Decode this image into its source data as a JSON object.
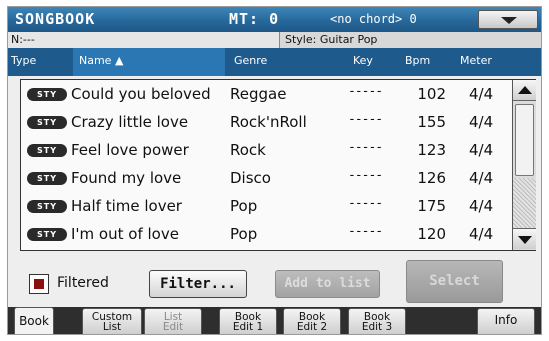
{
  "header": {
    "title": "SONGBOOK",
    "mt": "MT: 0",
    "chord": "<no chord> 0"
  },
  "info": {
    "n_label": "N:---",
    "style": "Style: Guitar Pop"
  },
  "columns": {
    "type": "Type",
    "name": "Name ▲",
    "genre": "Genre",
    "key": "Key",
    "bpm": "Bpm",
    "meter": "Meter"
  },
  "rows": [
    {
      "badge": "STY",
      "name": "Could you beloved",
      "genre": "Reggae",
      "key": "-----",
      "bpm": "102",
      "meter": "4/4"
    },
    {
      "badge": "STY",
      "name": "Crazy little love",
      "genre": "Rock'nRoll",
      "key": "-----",
      "bpm": "155",
      "meter": "4/4"
    },
    {
      "badge": "STY",
      "name": "Feel love power",
      "genre": "Rock",
      "key": "-----",
      "bpm": "123",
      "meter": "4/4"
    },
    {
      "badge": "STY",
      "name": "Found my love",
      "genre": "Disco",
      "key": "-----",
      "bpm": "126",
      "meter": "4/4"
    },
    {
      "badge": "STY",
      "name": "Half time lover",
      "genre": "Pop",
      "key": "-----",
      "bpm": "175",
      "meter": "4/4"
    },
    {
      "badge": "STY",
      "name": "I'm out of love",
      "genre": "Pop",
      "key": "-----",
      "bpm": "120",
      "meter": "4/4"
    }
  ],
  "controls": {
    "filtered_label": "Filtered",
    "filtered_checked": true,
    "filter_button": "Filter...",
    "add_to_list_button": "Add to list",
    "select_button": "Select"
  },
  "tabs": [
    {
      "line1": "Book",
      "line2": ""
    },
    {
      "line1": "Custom",
      "line2": "List"
    },
    {
      "line1": "List",
      "line2": "Edit"
    },
    {
      "line1": "Book",
      "line2": "Edit 1"
    },
    {
      "line1": "Book",
      "line2": "Edit 2"
    },
    {
      "line1": "Book",
      "line2": "Edit 3"
    },
    {
      "line1": "Info",
      "line2": ""
    }
  ],
  "colors": {
    "title_bar": "#27689b",
    "column_header": "#1e5a8c",
    "selected_column": "#2a77b3",
    "checkbox_fill": "#8a1010"
  }
}
